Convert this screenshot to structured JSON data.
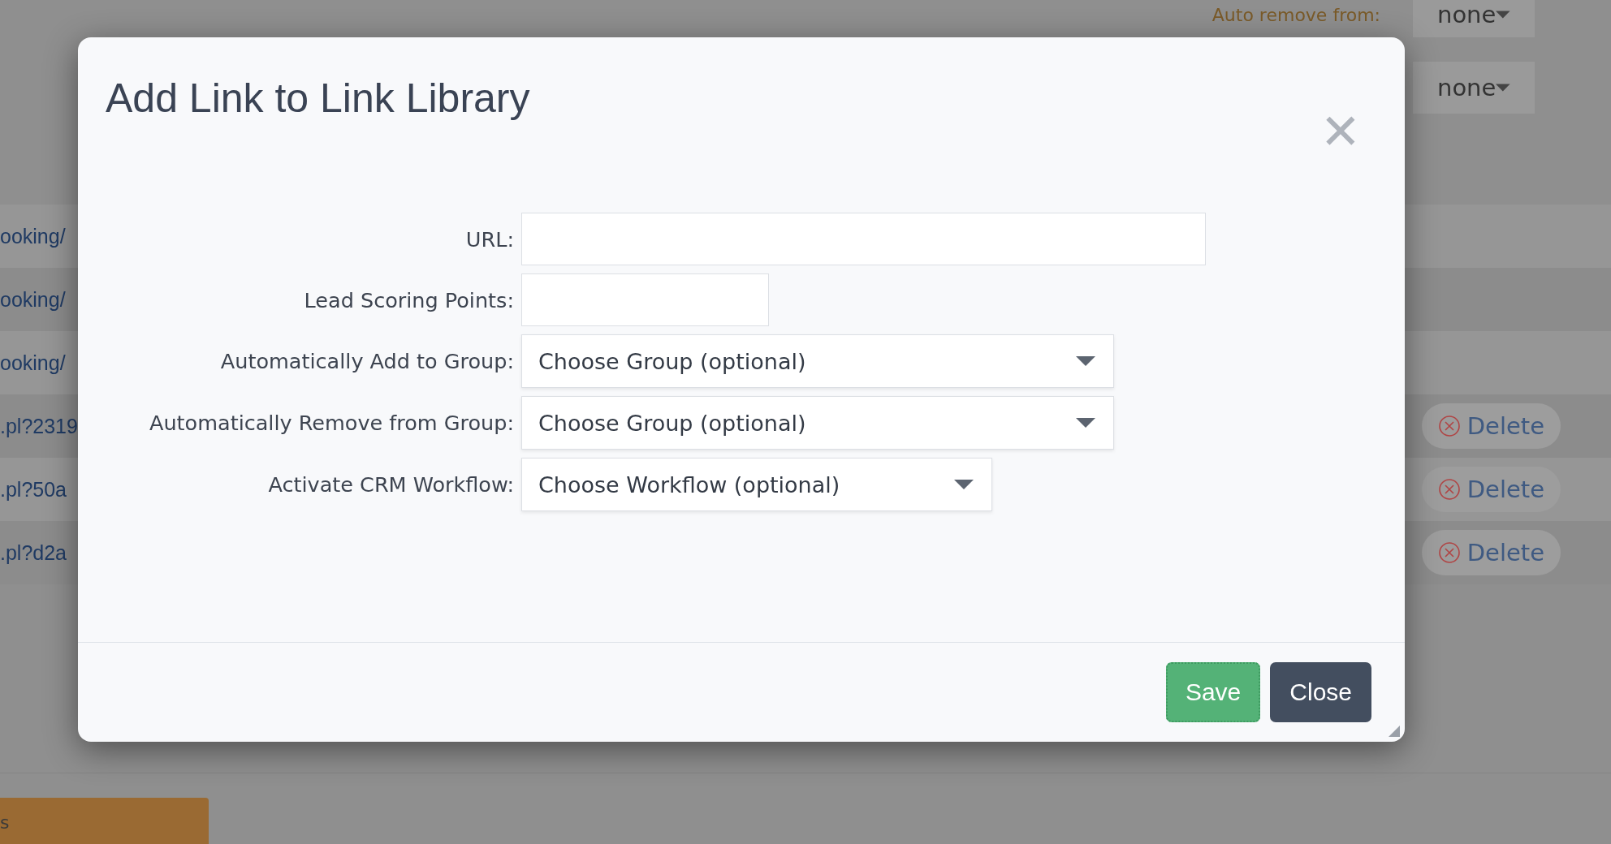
{
  "background": {
    "auto_remove_label": "Auto remove from:",
    "dropdowns": [
      "none",
      "none"
    ],
    "rows": [
      {
        "link": "ooking/",
        "delete": null
      },
      {
        "link": "ooking/",
        "delete": null
      },
      {
        "link": "ooking/",
        "delete": null
      },
      {
        "link": ".pl?2319",
        "delete": "Delete"
      },
      {
        "link": ".pl?50a",
        "delete": "Delete"
      },
      {
        "link": ".pl?d2a",
        "delete": "Delete"
      }
    ],
    "bottom_button": "s"
  },
  "dialog": {
    "title": "Add Link to Link Library",
    "close": "✕",
    "fields": [
      {
        "label": "URL:",
        "kind": "text"
      },
      {
        "label": "Lead Scoring Points:",
        "kind": "text"
      },
      {
        "label": "Automatically Add to Group:",
        "kind": "select",
        "placeholder": "Choose Group (optional)"
      },
      {
        "label": "Automatically Remove from Group:",
        "kind": "select",
        "placeholder": "Choose Group (optional)"
      },
      {
        "label": "Activate CRM Workflow:",
        "kind": "select",
        "placeholder": "Choose Workflow (optional)"
      }
    ],
    "buttons": [
      {
        "label": "Save",
        "kind": "primary",
        "focused": true
      },
      {
        "label": "Close",
        "kind": "secondary",
        "focused": false
      }
    ]
  }
}
